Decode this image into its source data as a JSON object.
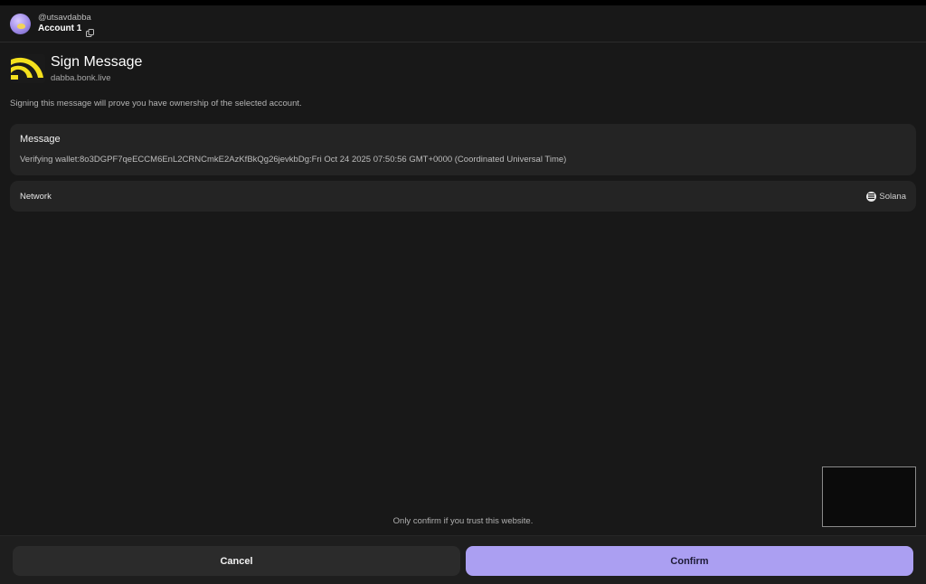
{
  "header": {
    "username": "@utsavdabba",
    "account_name": "Account 1"
  },
  "dapp": {
    "title": "Sign Message",
    "domain": "dabba.bonk.live",
    "logo_color": "#F4E01D"
  },
  "subtitle": "Signing this message will prove you have ownership of the selected account.",
  "message": {
    "label": "Message",
    "text": "Verifying wallet:8o3DGPF7qeECCM6EnL2CRNCmkE2AzKfBkQg26jevkbDg:Fri Oct 24 2025 07:50:56 GMT+0000 (Coordinated Universal Time)"
  },
  "network": {
    "label": "Network",
    "value": "Solana",
    "icon": "solana-icon"
  },
  "trust_note": "Only confirm if you trust this website.",
  "buttons": {
    "cancel": "Cancel",
    "confirm": "Confirm"
  },
  "colors": {
    "background": "#181818",
    "card": "#242424",
    "accent": "#AB9FF2"
  }
}
